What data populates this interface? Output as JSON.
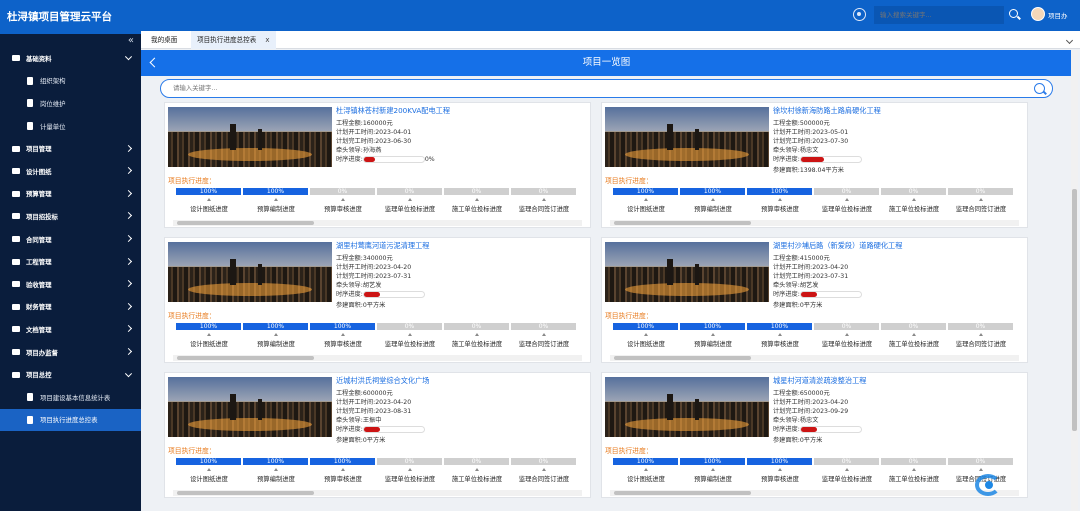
{
  "brand": "杜浔镇项目管理云平台",
  "sidebar": {
    "collapse_glyph": "«",
    "groups": [
      {
        "label": "基础资料",
        "expanded": true
      },
      {
        "label": "项目管理"
      },
      {
        "label": "设计图纸"
      },
      {
        "label": "预算管理"
      },
      {
        "label": "项目招投标"
      },
      {
        "label": "合同管理"
      },
      {
        "label": "工程管理"
      },
      {
        "label": "验收管理"
      },
      {
        "label": "财务管理"
      },
      {
        "label": "文档管理"
      },
      {
        "label": "项目办监督"
      },
      {
        "label": "项目总控",
        "expanded": true
      }
    ],
    "sub_basic": [
      "组织架构",
      "岗位维护",
      "计量单位"
    ],
    "sub_control": [
      "项目建设基本信息统计表",
      "项目执行进度总控表"
    ]
  },
  "topbar": {
    "search_placeholder": "输入搜索关键字...",
    "user_name": "项目办"
  },
  "tabs": {
    "home": "我的桌面",
    "active": "项目执行进度总控表",
    "close": "x"
  },
  "page": {
    "title": "项目一览图",
    "search_placeholder": "请输入关键字..."
  },
  "labels": {
    "progress": "项目执行进度："
  },
  "step_names": [
    "设计图纸进度",
    "预算编制进度",
    "预算审核进度",
    "监理单位投标进度",
    "施工单位投标进度",
    "监理合同签订进度"
  ],
  "projects": [
    {
      "title": "杜浔镇林苍村新建200KVA配电工程",
      "amount": "工程金额:160000元",
      "start": "计划开工时间:2023-04-01",
      "end": "计划完工时间:2023-06-30",
      "leader": "牵头领导:孙海燕",
      "time_label": "时序进度:",
      "time_text": "0%",
      "time_fill": 0.19,
      "area": "",
      "steps": [
        "100%",
        "100%",
        "0%",
        "0%",
        "0%",
        "0%"
      ]
    },
    {
      "title": "徐坎村徐新海防路土路肩硬化工程",
      "amount": "工程金额:500000元",
      "start": "计划开工时间:2023-05-01",
      "end": "计划完工时间:2023-07-30",
      "leader": "牵头领导:杨忠文",
      "time_label": "时序进度:",
      "time_text": "",
      "time_fill": 0.38,
      "area": "参建面积:1398.04平方米",
      "steps": [
        "100%",
        "100%",
        "100%",
        "0%",
        "0%",
        "0%"
      ]
    },
    {
      "title": "湖里村莺鹰河道污泥清理工程",
      "amount": "工程金额:340000元",
      "start": "计划开工时间:2023-04-20",
      "end": "计划完工时间:2023-07-31",
      "leader": "牵头领导:胡艺发",
      "time_label": "时序进度:",
      "time_text": "",
      "time_fill": 0.27,
      "area": "参建面积:0平方米",
      "steps": [
        "100%",
        "100%",
        "100%",
        "0%",
        "0%",
        "0%"
      ]
    },
    {
      "title": "湖里村沙埔后路（新爱段）道路硬化工程",
      "amount": "工程金额:415000元",
      "start": "计划开工时间:2023-04-20",
      "end": "计划完工时间:2023-07-31",
      "leader": "牵头领导:胡艺发",
      "time_label": "时序进度:",
      "time_text": "",
      "time_fill": 0.27,
      "area": "参建面积:0平方米",
      "steps": [
        "100%",
        "100%",
        "100%",
        "0%",
        "0%",
        "0%"
      ]
    },
    {
      "title": "近城村洪氏祠堂综合文化广场",
      "amount": "工程金额:600000元",
      "start": "计划开工时间:2023-04-20",
      "end": "计划完工时间:2023-08-31",
      "leader": "牵头领导:王振中",
      "time_label": "时序进度:",
      "time_text": "",
      "time_fill": 0.27,
      "area": "参建面积:0平方米",
      "steps": [
        "100%",
        "100%",
        "100%",
        "0%",
        "0%",
        "0%"
      ]
    },
    {
      "title": "城星村河道清淤疏浚整治工程",
      "amount": "工程金额:650000元",
      "start": "计划开工时间:2023-04-20",
      "end": "计划完工时间:2023-09-29",
      "leader": "牵头领导:杨忠文",
      "time_label": "时序进度:",
      "time_text": "",
      "time_fill": 0.27,
      "area": "参建面积:0平方米",
      "steps": [
        "100%",
        "100%",
        "100%",
        "0%",
        "0%",
        "0%"
      ]
    }
  ],
  "colors": {
    "brand_blue": "#0d62c9",
    "sidebar_bg": "#0a1d3c",
    "step_done": "#1663e0",
    "step_todo": "#cfcfcf",
    "time_red": "#cc1414",
    "progress_orange": "#e87a1c"
  }
}
